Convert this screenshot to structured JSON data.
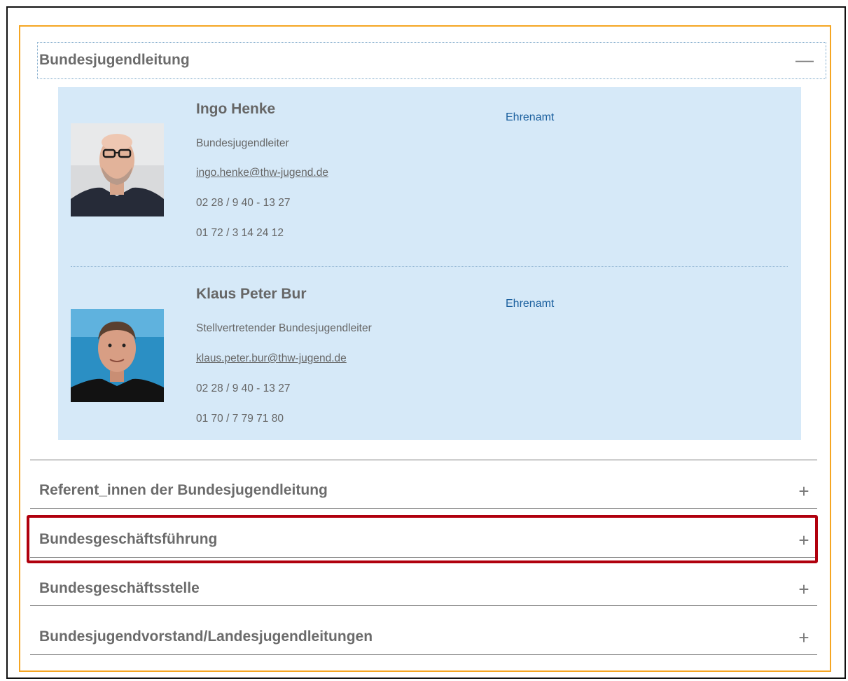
{
  "accordion": {
    "open_section": {
      "title": "Bundesjugendleitung",
      "toggle": "—",
      "people": [
        {
          "name": "Ingo Henke",
          "role": "Bundesjugendleiter",
          "email": "ingo.henke@thw-jugend.de",
          "phone": "02 28 / 9 40 - 13 27",
          "mobile": "01 72 / 3 14 24 12",
          "tag": "Ehrenamt"
        },
        {
          "name": "Klaus Peter Bur",
          "role": "Stellvertretender Bundesjugendleiter",
          "email": "klaus.peter.bur@thw-jugend.de",
          "phone": "02 28 / 9 40 - 13 27",
          "mobile": "01 70 / 7 79 71 80",
          "tag": "Ehrenamt"
        }
      ]
    },
    "collapsed_sections": [
      {
        "title": "Referent_innen der Bundesjugendleitung",
        "toggle": "+"
      },
      {
        "title": "Bundesgeschäftsführung",
        "toggle": "+",
        "highlighted": true
      },
      {
        "title": "Bundesgeschäftsstelle",
        "toggle": "+"
      },
      {
        "title": "Bundesjugendvorstand/Landesjugendleitungen",
        "toggle": "+"
      }
    ]
  },
  "colors": {
    "accent_frame": "#f5a623",
    "panel_bg": "#d6e9f8",
    "tag_text": "#1a5f9e",
    "highlight_border": "#b0000d"
  }
}
